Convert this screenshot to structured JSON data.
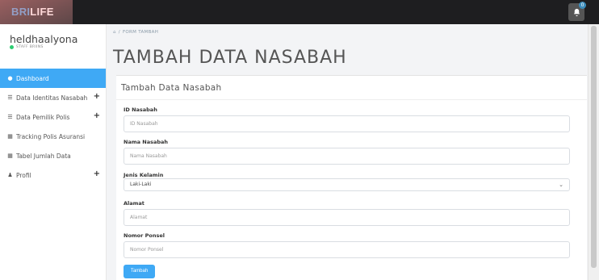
{
  "topbar": {
    "brand_part1": "BRI",
    "brand_part2": "LIFE",
    "notification_count": "0"
  },
  "sidebar": {
    "user_name": "heldhaalyona",
    "user_role": "STAFF BRIINS",
    "items": [
      {
        "label": "Dashboard",
        "icon": "dashboard-icon",
        "active": true
      },
      {
        "label": "Data Identitas Nasabah",
        "icon": "list-icon",
        "has_plus": true
      },
      {
        "label": "Data Pemilik Polis",
        "icon": "list-icon",
        "has_plus": true
      },
      {
        "label": "Tracking Polis Asuransi",
        "icon": "calendar-icon"
      },
      {
        "label": "Tabel Jumlah Data",
        "icon": "calendar-icon"
      },
      {
        "label": "Profil",
        "icon": "user-icon",
        "has_plus": true
      }
    ]
  },
  "breadcrumb": {
    "current": "FORM TAMBAH"
  },
  "page_title": "TAMBAH DATA NASABAH",
  "form": {
    "title": "Tambah Data Nasabah",
    "fields": [
      {
        "label": "ID Nasabah",
        "placeholder": "ID Nasabah"
      },
      {
        "label": "Nama Nasabah",
        "placeholder": "Nama Nasabah"
      },
      {
        "label": "Jenis Kelamin",
        "value": "Laki-Laki"
      },
      {
        "label": "Alamat",
        "placeholder": "Alamat"
      },
      {
        "label": "Nomor Ponsel",
        "placeholder": "Nomor Ponsel"
      }
    ],
    "submit_label": "Tambah"
  },
  "colors": {
    "topbar": "#1e1e20",
    "accent": "#3fa9f5",
    "brand_blue": "#3aa0e8"
  }
}
